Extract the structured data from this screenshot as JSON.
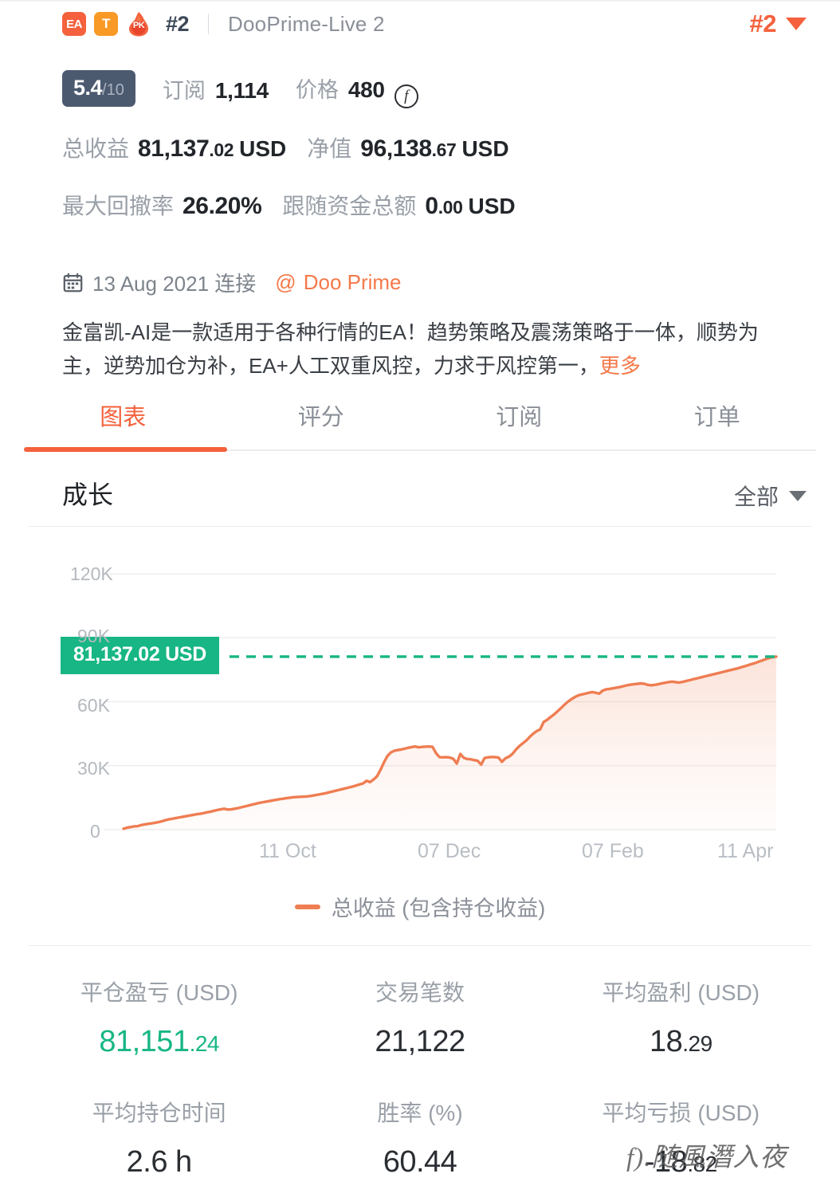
{
  "header": {
    "badges": [
      "EA",
      "T",
      "PK"
    ],
    "rank_inline": "#2",
    "account_name": "DooPrime-Live 2",
    "rank_right": "#2",
    "caret_icon": "chevron-down-icon"
  },
  "rating": {
    "score": "5.4",
    "scale": "/10",
    "subscribe_label": "订阅",
    "subscribe_value": "1,114",
    "price_label": "价格",
    "price_value": "480",
    "coin_icon": "f-coin-icon"
  },
  "stats_top": {
    "total_profit_label": "总收益",
    "total_profit_int": "81,137",
    "total_profit_dec": ".02",
    "total_profit_unit": "USD",
    "equity_label": "净值",
    "equity_int": "96,138",
    "equity_dec": ".67",
    "equity_unit": "USD",
    "max_drawdown_label": "最大回撤率",
    "max_drawdown_value": "26.20%",
    "follow_funds_label": "跟随资金总额",
    "follow_funds_int": "0",
    "follow_funds_dec": ".00",
    "follow_funds_unit": "USD"
  },
  "connect": {
    "calendar_icon": "calendar-icon",
    "date": "13 Aug 2021",
    "connect_label": "连接",
    "at_symbol": "@",
    "broker": "Doo Prime"
  },
  "description": {
    "text": "金富凯-AI是一款适用于各种行情的EA！趋势策略及震荡策略于一体，顺势为主，逆势加仓为补，EA+人工双重风控，力求于风控第一，",
    "more_label": "更多"
  },
  "tabs": [
    {
      "label": "图表",
      "active": true
    },
    {
      "label": "评分",
      "active": false
    },
    {
      "label": "订阅",
      "active": false
    },
    {
      "label": "订单",
      "active": false
    }
  ],
  "growth": {
    "title": "成长",
    "filter_label": "全部",
    "filter_caret": "chevron-down-icon"
  },
  "chart_data": {
    "type": "area",
    "title": "成长",
    "xlabel": "",
    "ylabel": "",
    "ylim": [
      0,
      120000
    ],
    "ytick_labels": [
      "120K",
      "90K",
      "60K",
      "30K",
      "0"
    ],
    "ytick_values": [
      120000,
      90000,
      60000,
      30000,
      0
    ],
    "xtick_labels": [
      "11 Oct",
      "07 Dec",
      "07 Feb",
      "11 Apr"
    ],
    "grid": true,
    "legend_position": "bottom",
    "series": [
      {
        "name": "总收益 (包含持仓收益)",
        "color": "#ef7d52",
        "values": [
          400,
          900,
          1200,
          1500,
          1600,
          2100,
          2400,
          2700,
          2900,
          3200,
          3500,
          3900,
          4400,
          4800,
          5100,
          5400,
          5700,
          6000,
          6300,
          6600,
          6900,
          7200,
          7400,
          7700,
          8100,
          8400,
          8800,
          9200,
          9500,
          9800,
          9400,
          9500,
          9800,
          10100,
          10500,
          10900,
          11300,
          11700,
          12100,
          12500,
          12800,
          13100,
          13400,
          13700,
          14000,
          14300,
          14500,
          14800,
          15000,
          15200,
          15300,
          15400,
          15500,
          15600,
          15800,
          16100,
          16400,
          16700,
          17000,
          17400,
          17800,
          18200,
          18600,
          19000,
          19400,
          19800,
          20200,
          20700,
          21200,
          21700,
          22900,
          22300,
          23500,
          25000,
          28000,
          31500,
          34500,
          36200,
          37000,
          37300,
          37600,
          38000,
          38400,
          38700,
          39000,
          38600,
          38800,
          38900,
          39000,
          38800,
          35900,
          34000,
          33900,
          34000,
          33800,
          33200,
          31000,
          35500,
          33700,
          33100,
          33000,
          32600,
          32300,
          30500,
          33600,
          33900,
          34100,
          34000,
          33800,
          31800,
          33500,
          34200,
          35500,
          37500,
          39200,
          40500,
          41800,
          43500,
          45000,
          46200,
          47000,
          50500,
          51500,
          52800,
          54000,
          55500,
          57000,
          58600,
          60000,
          61200,
          62200,
          63000,
          63400,
          63800,
          64200,
          64500,
          64200,
          63800,
          65200,
          65800,
          66000,
          66300,
          66600,
          66900,
          67300,
          67700,
          68000,
          68200,
          68400,
          68600,
          68400,
          67900,
          67700,
          67900,
          68200,
          68600,
          68900,
          69200,
          69400,
          69200,
          69000,
          69300,
          69700,
          70100,
          70500,
          70900,
          71300,
          71700,
          72100,
          72500,
          72900,
          73300,
          73700,
          74100,
          74500,
          74900,
          75300,
          75700,
          76200,
          76700,
          77200,
          77700,
          78200,
          78800,
          79400,
          80000,
          80500,
          80900,
          81137
        ]
      }
    ],
    "highlight": {
      "label": "81,137.02 USD",
      "value": 81137.02,
      "color": "#17b684",
      "line_style": "dashed"
    },
    "legend": [
      {
        "label": "总收益 (包含持仓收益)",
        "color": "#ef7d52"
      }
    ]
  },
  "metrics": [
    [
      {
        "label": "平仓盈亏 (USD)",
        "int": "81,151",
        "dec": ".24",
        "accent": "teal"
      },
      {
        "label": "交易笔数",
        "int": "21,122",
        "dec": "",
        "accent": "dark"
      },
      {
        "label": "平均盈利 (USD)",
        "int": "18",
        "dec": ".29",
        "accent": "dark"
      }
    ],
    [
      {
        "label": "平均持仓时间",
        "int": "2.6 h",
        "dec": "",
        "accent": "dark"
      },
      {
        "label": "胜率 (%)",
        "int": "60.44",
        "dec": "",
        "accent": "dark"
      },
      {
        "label": "平均亏损 (USD)",
        "int": "-18",
        "dec": ".82",
        "accent": "dark"
      }
    ]
  ],
  "watermark": {
    "text": "f).随風潛入夜"
  },
  "colors": {
    "accent_orange": "#f4613c",
    "line_orange": "#ef7d52",
    "teal": "#17b684",
    "slate": "#4c5a70",
    "muted": "#9aa0a8"
  }
}
